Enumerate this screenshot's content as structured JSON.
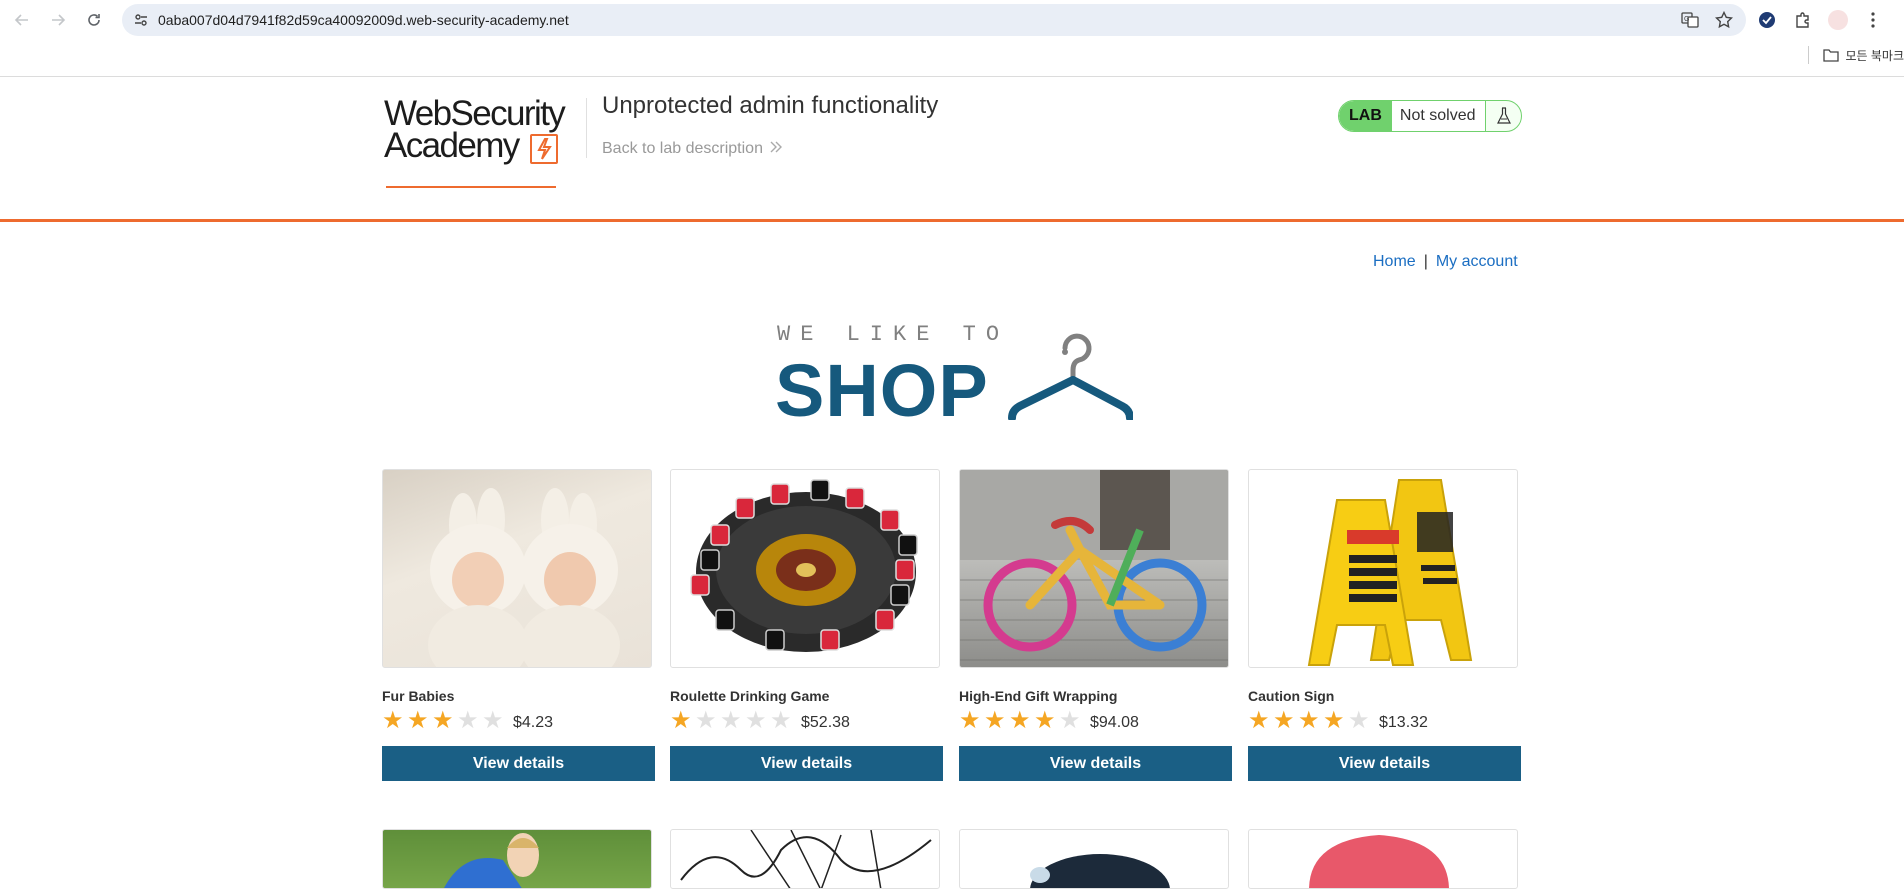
{
  "browser": {
    "url": "0aba007d04d7941f82d59ca40092009d.web-security-academy.net",
    "bookmarks_label": "모든 북마크"
  },
  "lab": {
    "logo_line1": "WebSecurity",
    "logo_line2": "Academy",
    "title": "Unprotected admin functionality",
    "back_link": "Back to lab description",
    "status_tag": "LAB",
    "status_text": "Not solved"
  },
  "nav": {
    "home": "Home",
    "separator": "|",
    "account": "My account"
  },
  "banner": {
    "small": "WE LIKE TO",
    "big": "SHOP"
  },
  "colors": {
    "accent_orange": "#ee6b2f",
    "button_blue": "#1a5f85",
    "star_gold": "#f5a623",
    "lab_green": "#70d16d",
    "link_blue": "#1b6ec2"
  },
  "products": [
    {
      "name": "Fur Babies",
      "rating": 3,
      "price": "$4.23",
      "button": "View details"
    },
    {
      "name": "Roulette Drinking Game",
      "rating": 1,
      "price": "$52.38",
      "button": "View details"
    },
    {
      "name": "High-End Gift Wrapping",
      "rating": 4,
      "price": "$94.08",
      "button": "View details"
    },
    {
      "name": "Caution Sign",
      "rating": 4,
      "price": "$13.32",
      "button": "View details"
    }
  ]
}
